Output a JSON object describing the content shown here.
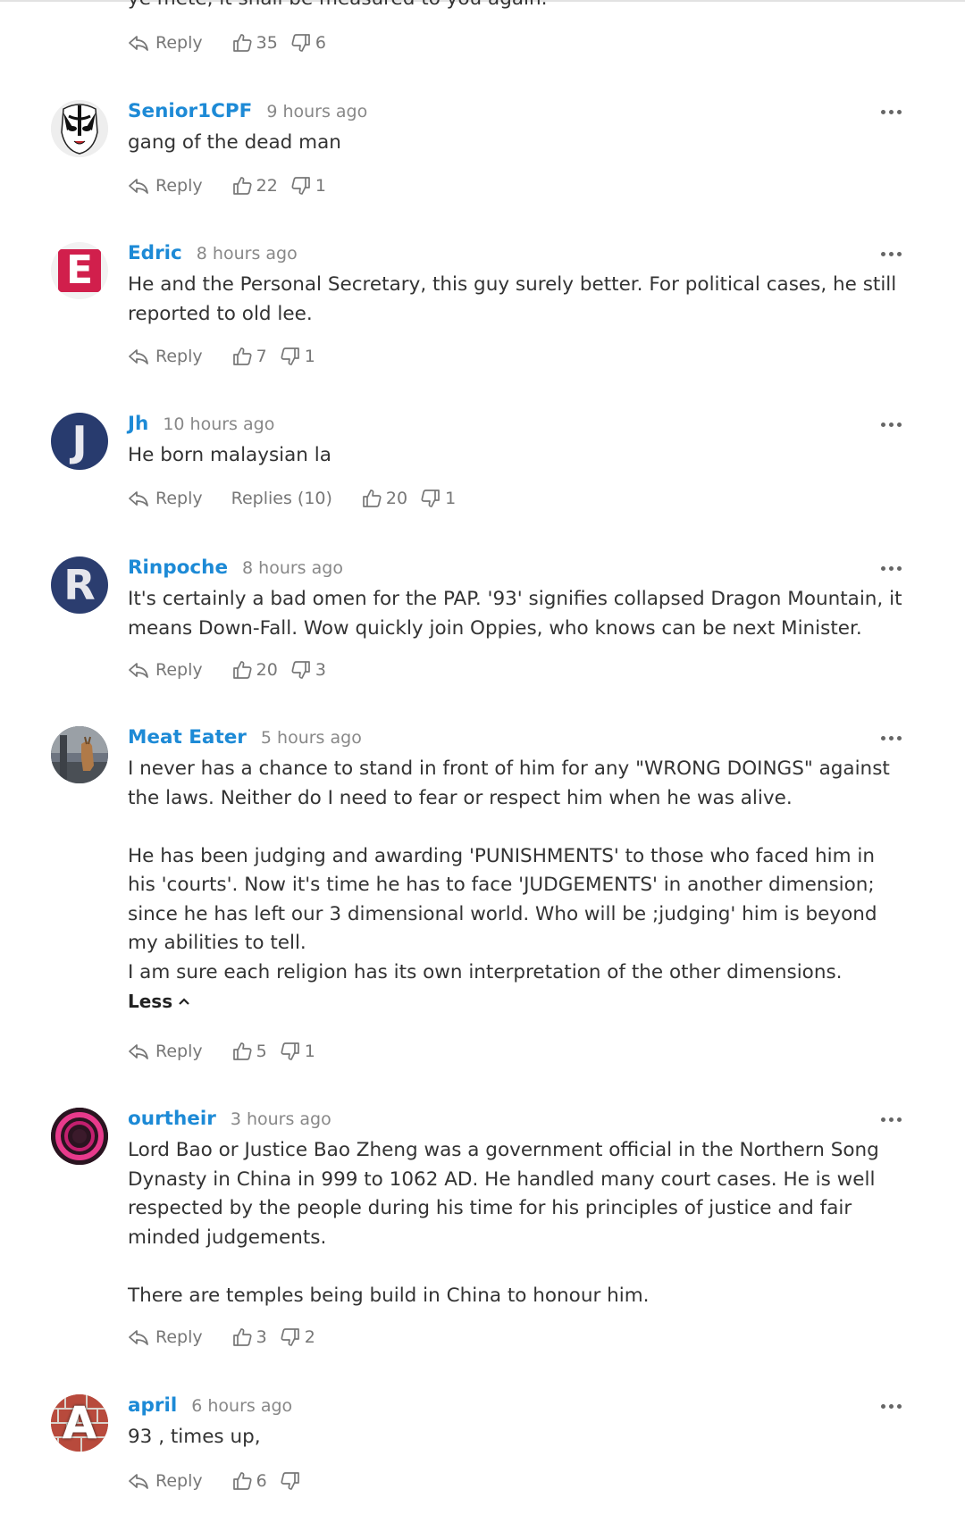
{
  "top_clipped_text": "ye mete, it shall be measured to you again.",
  "labels": {
    "reply": "Reply",
    "less": "Less"
  },
  "top_actions": {
    "likes": "35",
    "dislikes": "6"
  },
  "comments": [
    {
      "user": "Senior1CPF",
      "time": "9 hours ago",
      "avatar_icon": "opera-mask-avatar",
      "body": [
        "gang of the dead man"
      ],
      "likes": "22",
      "dislikes": "1"
    },
    {
      "user": "Edric",
      "time": "8 hours ago",
      "avatar_icon": "letter-e-avatar",
      "avatar_letter": "E",
      "body": [
        "He and the Personal Secretary, this guy surely better. For political cases, he still reported to old lee."
      ],
      "likes": "7",
      "dislikes": "1"
    },
    {
      "user": "Jh",
      "time": "10 hours ago",
      "avatar_icon": "letter-j-avatar",
      "avatar_letter": "J",
      "body": [
        "He born malaysian la"
      ],
      "replies": "Replies (10)",
      "likes": "20",
      "dislikes": "1"
    },
    {
      "user": "Rinpoche",
      "time": "8 hours ago",
      "avatar_icon": "letter-r-avatar",
      "avatar_letter": "R",
      "body": [
        "It's certainly a bad omen for the PAP. '93' signifies collapsed Dragon Mountain, it means Down-Fall. Wow quickly join Oppies, who knows can be next Minister."
      ],
      "likes": "20",
      "dislikes": "3"
    },
    {
      "user": "Meat Eater",
      "time": "5 hours ago",
      "avatar_icon": "deer-photo-avatar",
      "body": [
        "I never has a chance to stand in front of him for any \"WRONG DOINGS\" against the laws. Neither do I need to fear or respect him when he was alive.",
        "He has been judging and awarding 'PUNISHMENTS' to those who faced him in his 'courts'. Now it's time he has to face 'JUDGEMENTS' in another dimension; since he has left our 3 dimensional world. Who will be ;judging' him is beyond my abilities to tell.",
        "I am sure each religion has its own interpretation of the other dimensions."
      ],
      "likes": "5",
      "dislikes": "1"
    },
    {
      "user": "ourtheir",
      "time": "3 hours ago",
      "avatar_icon": "pink-ring-avatar",
      "body": [
        "Lord Bao or Justice Bao Zheng was a government official in the Northern Song Dynasty in China in 999 to 1062 AD. He handled many court cases. He is well respected by the people during his time for his principles of justice and fair minded judgements.",
        "There are temples being build in China to honour him."
      ],
      "likes": "3",
      "dislikes": "2"
    },
    {
      "user": "april",
      "time": "6 hours ago",
      "avatar_icon": "letter-a-avatar",
      "avatar_letter": "A",
      "body": [
        "93 , times up,"
      ],
      "likes": "6",
      "dislikes": ""
    }
  ],
  "colors": {
    "username": "#1d8ad6",
    "meta": "#888888",
    "action": "#777777",
    "text": "#333333"
  }
}
